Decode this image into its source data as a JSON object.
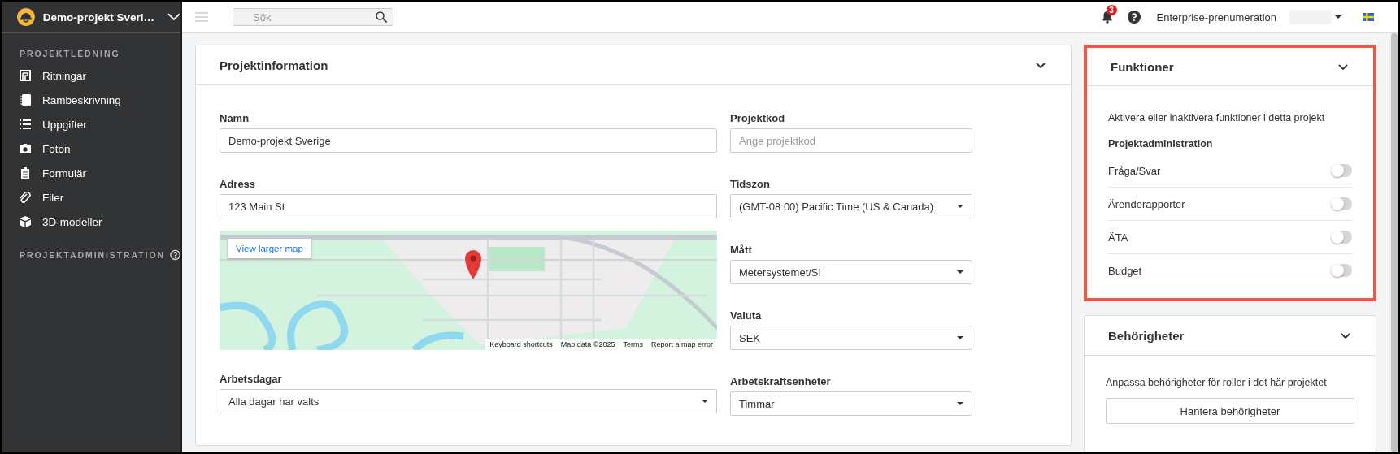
{
  "sidebar": {
    "project_title": "Demo-projekt Sveri…",
    "sections": [
      {
        "heading": "PROJEKTLEDNING",
        "items": [
          {
            "label": "Ritningar"
          },
          {
            "label": "Rambeskrivning"
          },
          {
            "label": "Uppgifter"
          },
          {
            "label": "Foton"
          },
          {
            "label": "Formulär"
          },
          {
            "label": "Filer"
          },
          {
            "label": "3D-modeller"
          }
        ]
      },
      {
        "heading": "PROJEKTADMINISTRATION",
        "help": true
      }
    ]
  },
  "topbar": {
    "search": {
      "placeholder": "Sök"
    },
    "notifications": "3",
    "subscription": "Enterprise-prenumeration"
  },
  "project_info": {
    "title": "Projektinformation",
    "left_fields": [
      {
        "kind": "text",
        "label": "Namn",
        "value": "Demo-projekt Sverige"
      },
      {
        "kind": "text",
        "label": "Adress",
        "value": "123 Main St"
      },
      {
        "kind": "map",
        "button": "View larger map",
        "attribution": [
          "Keyboard shortcuts",
          "Map data ©2025",
          "Terms",
          "Report a map error"
        ]
      },
      {
        "kind": "select",
        "label": "Arbetsdagar",
        "value": "Alla dagar har valts"
      }
    ],
    "right_fields": [
      {
        "kind": "text",
        "label": "Projektkod",
        "placeholder": "Ange projektkod"
      },
      {
        "kind": "select",
        "label": "Tidszon",
        "value": "(GMT-08:00) Pacific Time (US & Canada)"
      },
      {
        "kind": "select",
        "label": "Mått",
        "value": "Metersystemet/SI"
      },
      {
        "kind": "select",
        "label": "Valuta",
        "value": "SEK"
      },
      {
        "kind": "select",
        "label": "Arbetskraftsenheter",
        "value": "Timmar"
      }
    ]
  },
  "features": {
    "title": "Funktioner",
    "highlighted": true,
    "description": "Aktivera eller inaktivera funktioner i detta projekt",
    "group": "Projektadministration",
    "toggles": [
      {
        "label": "Fråga/Svar",
        "on": false
      },
      {
        "label": "Ärenderapporter",
        "on": false
      },
      {
        "label": "ÄTA",
        "on": false
      },
      {
        "label": "Budget",
        "on": false
      }
    ]
  },
  "permissions": {
    "title": "Behörigheter",
    "description": "Anpassa behörigheter för roller i det här projektet",
    "button": "Hantera behörigheter"
  }
}
